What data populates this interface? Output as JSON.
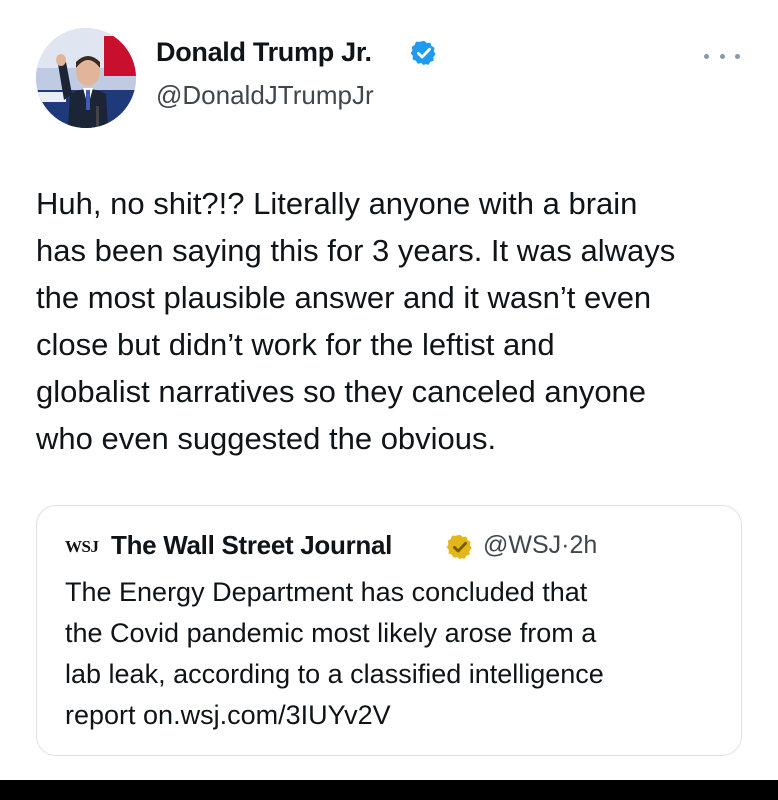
{
  "tweet": {
    "author_name": "Donald Trump Jr.",
    "author_handle": "@DonaldJTrumpJr",
    "text": "Huh, no shit?!? Literally anyone with a brain\nhas been saying this for 3 years. It was always\nthe most plausible answer and it wasn’t even\nclose but didn’t work for the leftist and\nglobalist narratives so they canceled anyone\nwho even suggested the obvious."
  },
  "quote": {
    "logo_text": "WSJ",
    "author_name": "The Wall Street Journal",
    "author_handle": "@WSJ",
    "separator": "·",
    "time": "2h",
    "text": "The Energy Department has concluded that\nthe Covid pandemic most likely arose from a\nlab leak, according to a classified intelligence\nreport  on.wsj.com/3IUYv2V"
  },
  "icons": {
    "verified": "verified-badge-blue",
    "gold_verified": "verified-badge-gold",
    "more": "more-horizontal-icon"
  },
  "colors": {
    "verified_blue": "#1d9bf0",
    "gold_badge": "#e2b719",
    "text_primary": "#0f1419",
    "text_secondary": "#3f474d",
    "card_border": "#dde2e6"
  }
}
